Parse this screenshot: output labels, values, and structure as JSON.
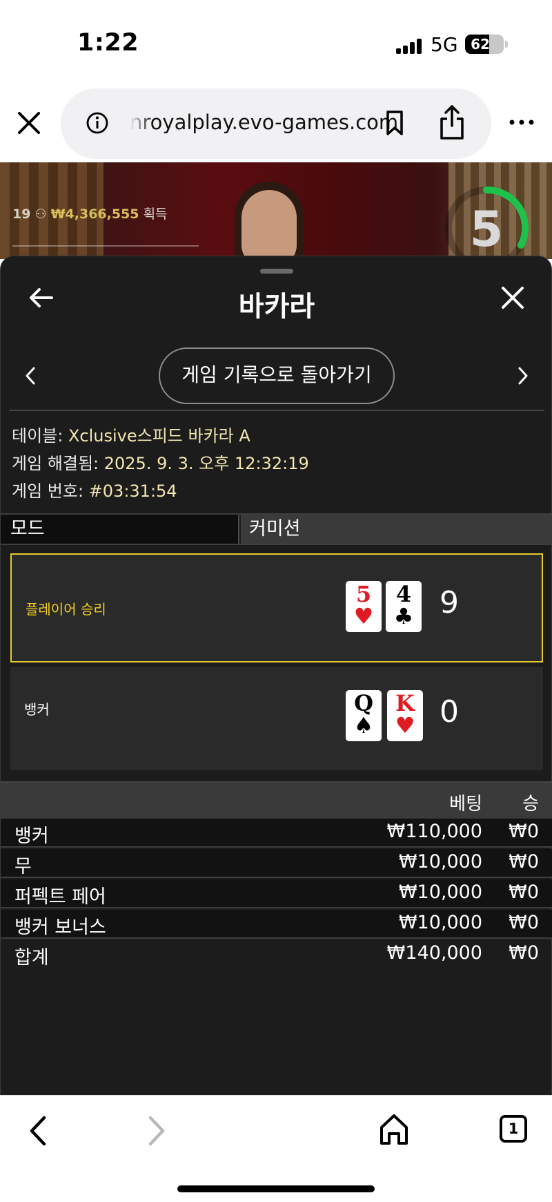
{
  "status_bar": {
    "time": "1:22",
    "network": "5G",
    "battery": "62",
    "battery_level": 0.62
  },
  "browser": {
    "url": "nroyalplay.evo-games.com"
  },
  "video": {
    "player_count": "19",
    "amount": "₩4,366,555",
    "amount_suffix": "획득",
    "timer": "5"
  },
  "panel": {
    "title": "바카라",
    "history_button": "게임 기록으로 돌아가기",
    "info": {
      "table_label": "테이블: ",
      "table_value": "Xclusive스피드 바카라 A",
      "resolved_label": "게임 해결됨: ",
      "resolved_value": "2025. 9. 3. 오후 12:32:19",
      "game_no_label": "게임 번호: ",
      "game_no_value": "#03:31:54"
    },
    "mode": {
      "label": "모드",
      "value": "커미션"
    },
    "results": {
      "player": {
        "label": "플레이어 승리",
        "cards": [
          {
            "rank": "5",
            "suit": "♥"
          },
          {
            "rank": "4",
            "suit": "♣"
          }
        ],
        "score": "9"
      },
      "banker": {
        "label": "뱅커",
        "cards": [
          {
            "rank": "Q",
            "suit": "♠"
          },
          {
            "rank": "K",
            "suit": "♥"
          }
        ],
        "score": "0"
      }
    },
    "bets": {
      "header": {
        "bet": "베팅",
        "win": "승"
      },
      "rows": [
        {
          "name": "뱅커",
          "bet": "₩110,000",
          "win": "₩0"
        },
        {
          "name": "무",
          "bet": "₩10,000",
          "win": "₩0"
        },
        {
          "name": "퍼펙트 페어",
          "bet": "₩10,000",
          "win": "₩0"
        },
        {
          "name": "뱅커 보너스",
          "bet": "₩10,000",
          "win": "₩0"
        }
      ],
      "total": {
        "name": "합계",
        "bet": "₩140,000",
        "win": "₩0"
      }
    }
  },
  "toolbar": {
    "tab_count": "1"
  },
  "colors": {
    "accent_yellow": "#e2cb2f",
    "player_win_text": "#f3cf1f",
    "timer_green": "#1ec24a",
    "card_red": "#e01a22"
  }
}
